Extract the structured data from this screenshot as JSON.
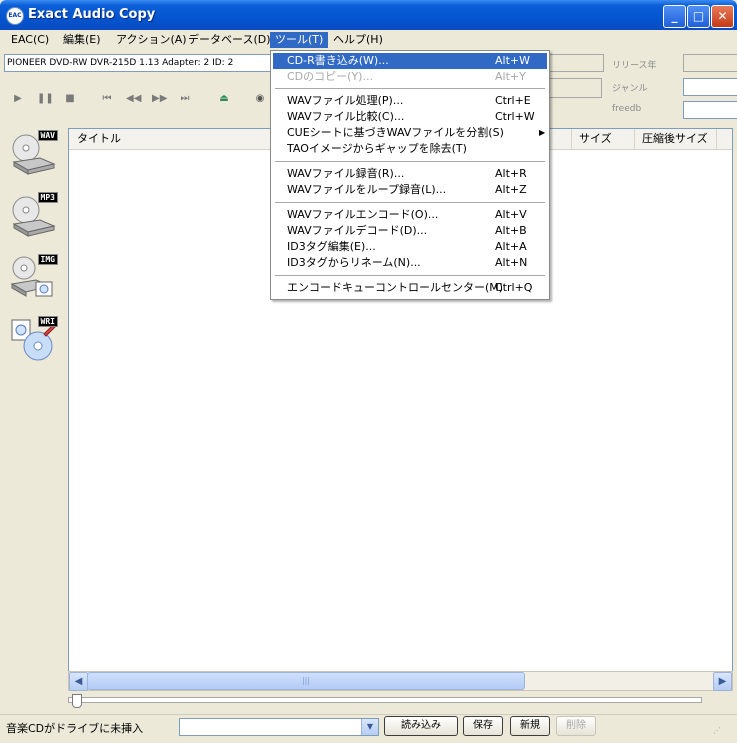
{
  "window": {
    "title": "Exact Audio Copy",
    "icon_text": "EAC"
  },
  "menubar": [
    "EAC(C)",
    "編集(E)",
    "アクション(A)",
    "データベース(D)",
    "ツール(T)",
    "ヘルプ(H)"
  ],
  "drive": {
    "selected": "PIONEER DVD-RW  DVR-215D 1.13   Adapter: 2  ID: 2"
  },
  "right_panel": {
    "release_year": "リリース年",
    "genre": "ジャンル",
    "freedb": "freedb"
  },
  "sidebar": {
    "wav": "WAV",
    "mp3": "MP3",
    "img": "IMG",
    "wri": "WRI"
  },
  "list": {
    "columns": {
      "title": "タイトル",
      "size": "サイズ",
      "compressed_size": "圧縮後サイズ"
    }
  },
  "tools_menu": {
    "items": [
      {
        "label": "CD-R書き込み(W)...",
        "shortcut": "Alt+W",
        "state": "highlighted"
      },
      {
        "label": "CDのコピー(Y)...",
        "shortcut": "Alt+Y",
        "state": "disabled"
      },
      {
        "label": "WAVファイル処理(P)...",
        "shortcut": "Ctrl+E"
      },
      {
        "label": "WAVファイル比較(C)...",
        "shortcut": "Ctrl+W"
      },
      {
        "label": "CUEシートに基づきWAVファイルを分割(S)",
        "shortcut": ""
      },
      {
        "label": "TAOイメージからギャップを除去(T)",
        "shortcut": ""
      },
      {
        "label": "WAVファイル録音(R)...",
        "shortcut": "Alt+R"
      },
      {
        "label": "WAVファイルをループ録音(L)...",
        "shortcut": "Alt+Z"
      },
      {
        "label": "WAVファイルエンコード(O)...",
        "shortcut": "Alt+V"
      },
      {
        "label": "WAVファイルデコード(D)...",
        "shortcut": "Alt+B"
      },
      {
        "label": "ID3タグ編集(E)...",
        "shortcut": "Alt+A"
      },
      {
        "label": "ID3タグからリネーム(N)...",
        "shortcut": "Alt+N"
      },
      {
        "label": "エンコードキューコントロールセンター(M)",
        "shortcut": "Ctrl+Q"
      }
    ]
  },
  "statusbar": {
    "text": "音楽CDがドライブに未挿入",
    "read_button": "読み込み",
    "save_button": "保存",
    "new_button": "新規",
    "delete_button": "削除"
  }
}
